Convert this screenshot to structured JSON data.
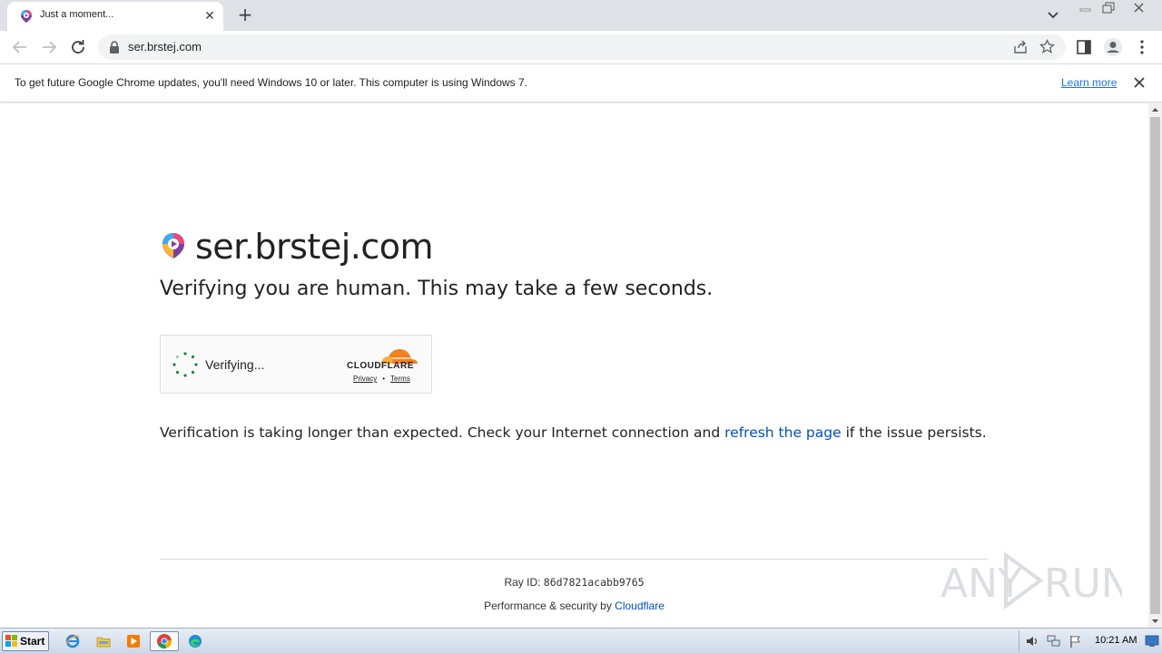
{
  "browser": {
    "tab": {
      "title": "Just a moment..."
    },
    "url": "ser.brstej.com"
  },
  "infobar": {
    "message": "To get future Google Chrome updates, you'll need Windows 10 or later. This computer is using Windows 7.",
    "learn_more": "Learn more"
  },
  "page": {
    "site_title": "ser.brstej.com",
    "subtitle": "Verifying you are human. This may take a few seconds.",
    "widget": {
      "status": "Verifying...",
      "brand": "CLOUDFLARE",
      "privacy": "Privacy",
      "separator": "•",
      "terms": "Terms"
    },
    "note": {
      "before": "Verification is taking longer than expected. Check your Internet connection and ",
      "link": "refresh the page",
      "after": " if the issue persists."
    },
    "ray_label": "Ray ID: ",
    "ray_id": "86d7821acabb9765",
    "perf_label": "Performance & security by ",
    "perf_link": "Cloudflare",
    "watermark": "ANY RUN"
  },
  "taskbar": {
    "start_label": "Start",
    "clock": "10:21 AM"
  },
  "colors": {
    "link": "#0051c3",
    "chrome_link": "#1a73e8",
    "cloudflare_orange": "#f38020"
  }
}
